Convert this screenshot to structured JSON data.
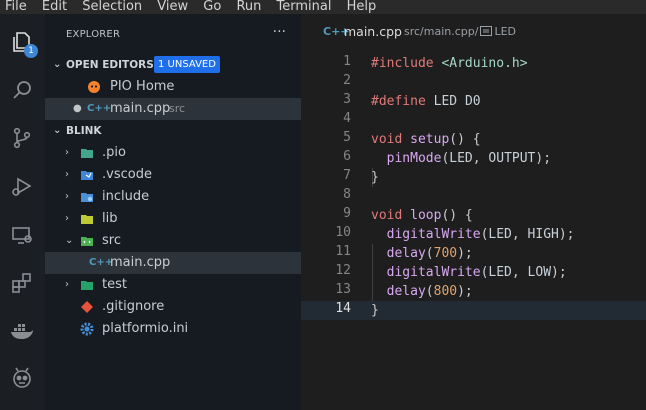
{
  "menu": [
    "File",
    "Edit",
    "Selection",
    "View",
    "Go",
    "Run",
    "Terminal",
    "Help"
  ],
  "explorer": {
    "title": "EXPLORER",
    "more": "···",
    "open_editors": {
      "label": "OPEN EDITORS",
      "badge": "1 UNSAVED",
      "items": [
        {
          "name": "PIO Home",
          "path": ""
        },
        {
          "name": "main.cpp",
          "path": "src"
        }
      ]
    },
    "project": {
      "label": "BLINK",
      "items": [
        "​.pio",
        ".vscode",
        "include",
        "lib",
        "src",
        "main.cpp",
        "test",
        ".gitignore",
        "platformio.ini"
      ]
    }
  },
  "tab": {
    "name": "main.cpp",
    "path": "src/main.cpp/",
    "symbol": "LED"
  },
  "code": {
    "line_numbers": [
      "1",
      "2",
      "3",
      "4",
      "5",
      "6",
      "7",
      "8",
      "9",
      "10",
      "11",
      "12",
      "13",
      "14"
    ],
    "lines": [
      "#include <Arduino.h>",
      "",
      "#define LED D0",
      "",
      "void setup() {",
      "  pinMode(LED, OUTPUT);",
      "}",
      "",
      "void loop() {",
      "  digitalWrite(LED, HIGH);",
      "  delay(700);",
      "  digitalWrite(LED, LOW);",
      "  delay(800);",
      "}"
    ]
  },
  "colors": {
    "accent": "#1f6feb",
    "badge": "#3e86d6"
  }
}
